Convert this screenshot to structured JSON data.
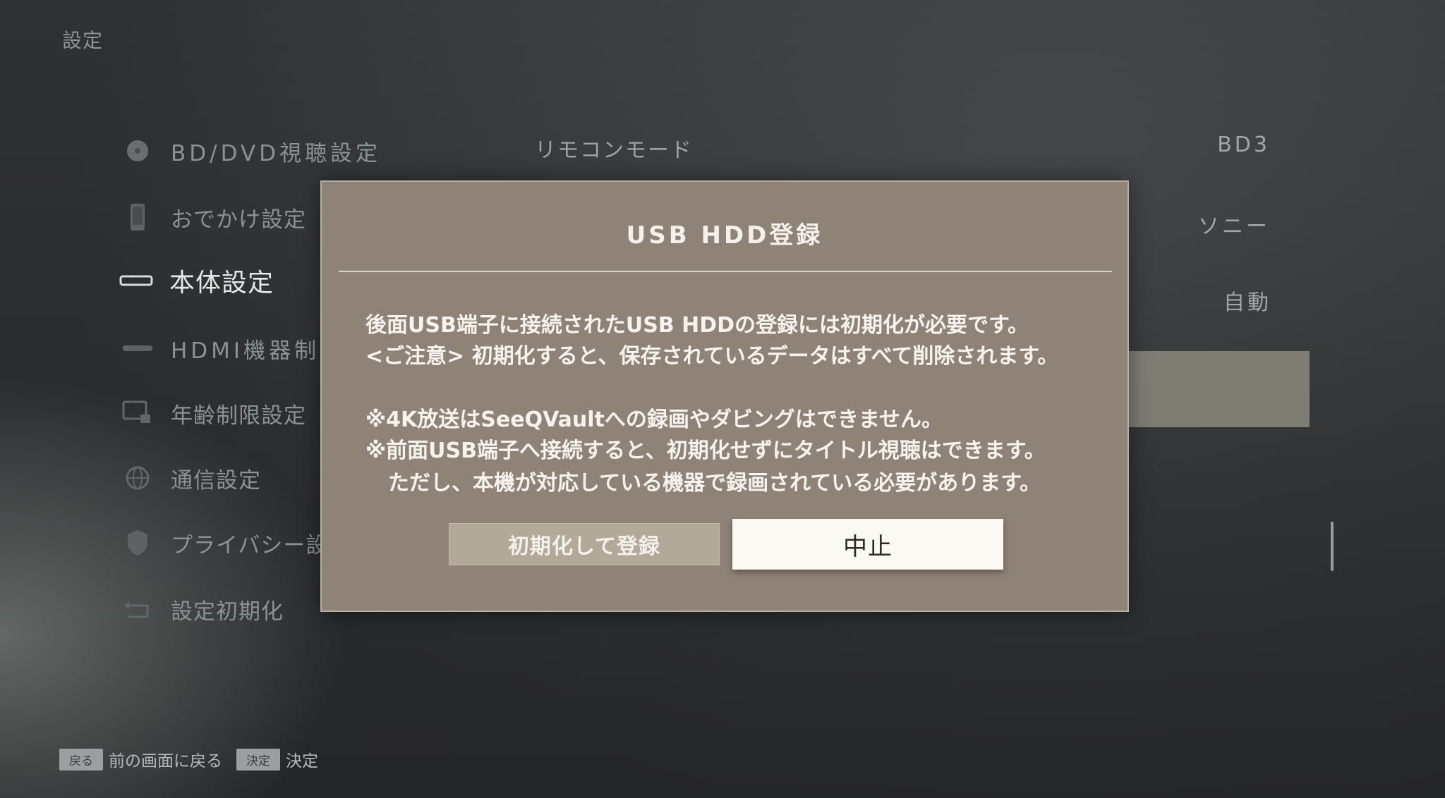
{
  "screen": {
    "title": "設定"
  },
  "sidebar": {
    "items": [
      {
        "label": "BD/DVD視聴設定",
        "icon": "disc-icon",
        "active": false
      },
      {
        "label": "おでかけ設定",
        "icon": "phone-icon",
        "active": false
      },
      {
        "label": "本体設定",
        "icon": "device-icon",
        "active": true
      },
      {
        "label": "HDMI機器制",
        "icon": "hdmi-icon",
        "active": false
      },
      {
        "label": "年齢制限設定",
        "icon": "parental-lock-icon",
        "active": false
      },
      {
        "label": "通信設定",
        "icon": "globe-icon",
        "active": false
      },
      {
        "label": "プライバシー設",
        "icon": "shield-icon",
        "active": false
      },
      {
        "label": "設定初期化",
        "icon": "reset-icon",
        "active": false
      }
    ]
  },
  "settings": {
    "rows": [
      {
        "label": "リモコンモード",
        "value": "BD3"
      },
      {
        "label": "",
        "value": "ソニー"
      },
      {
        "label": "",
        "value": "自動"
      }
    ]
  },
  "dialog": {
    "title": "USB HDD登録",
    "lines": [
      "後面USB端子に接続されたUSB HDDの登録には初期化が必要です。",
      "<ご注意> 初期化すると、保存されているデータはすべて削除されます。",
      "※4K放送はSeeQVaultへの録画やダビングはできません。",
      "※前面USB端子へ接続すると、初期化せずにタイトル視聴はできます。",
      "ただし、本機が対応している機器で録画されている必要があります。"
    ],
    "buttons": {
      "initialize": "初期化して登録",
      "cancel": "中止"
    }
  },
  "footer": {
    "back_key": "戻る",
    "back_text": "前の画面に戻る",
    "enter_key": "決定",
    "enter_text": "決定"
  },
  "colors": {
    "dialog_bg": "#8f8378",
    "button_focus": "#fbf9f3",
    "button_normal": "#b3a999"
  }
}
